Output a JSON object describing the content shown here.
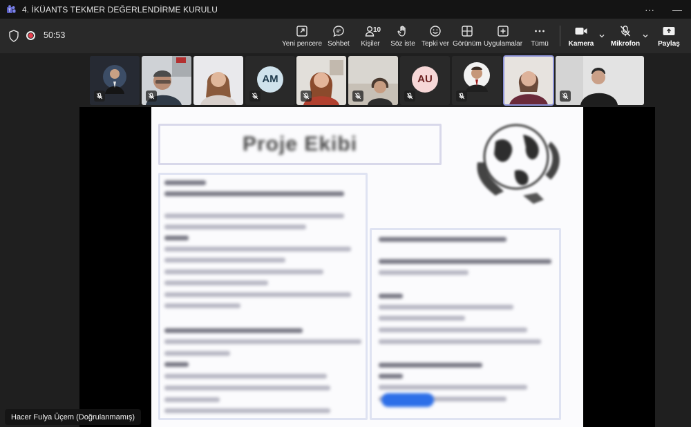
{
  "window": {
    "title": "4. İKÜANTS TEKMER DEĞERLENDİRME KURULU",
    "more_label": "···",
    "minimize_label": "—"
  },
  "meeting": {
    "timer": "50:53"
  },
  "toolbar": {
    "new_window": "Yeni pencere",
    "chat": "Sohbet",
    "people": "Kişiler",
    "people_count": "10",
    "raise_hand": "Söz iste",
    "react": "Tepki ver",
    "view": "Görünüm",
    "apps": "Uygulamalar",
    "more": "Tümü",
    "camera": "Kamera",
    "mic": "Mikrofon",
    "share": "Paylaş"
  },
  "participants": [
    {
      "kind": "video",
      "muted": true
    },
    {
      "kind": "video",
      "muted": true
    },
    {
      "kind": "video",
      "muted": false
    },
    {
      "kind": "avatar",
      "initials": "AM",
      "muted": true
    },
    {
      "kind": "video",
      "muted": true
    },
    {
      "kind": "video",
      "muted": true
    },
    {
      "kind": "avatar",
      "initials": "AU",
      "muted": true
    },
    {
      "kind": "video",
      "muted": true
    },
    {
      "kind": "video",
      "muted": false,
      "active": true
    },
    {
      "kind": "video",
      "muted": true
    }
  ],
  "slide": {
    "title": "Proje Ekibi"
  },
  "presenter": {
    "name": "Hacer Fulya Üçem (Doğrulanmamış)"
  },
  "colors": {
    "titlebar": "#141414",
    "toolbar": "#292929",
    "record": "#e3404e",
    "active_outline": "#8d93d8",
    "avatar_am_bg": "#cfe2ec",
    "avatar_am_fg": "#1f3b4d",
    "avatar_au_bg": "#f6d7d7",
    "avatar_au_fg": "#6b1f1f"
  }
}
